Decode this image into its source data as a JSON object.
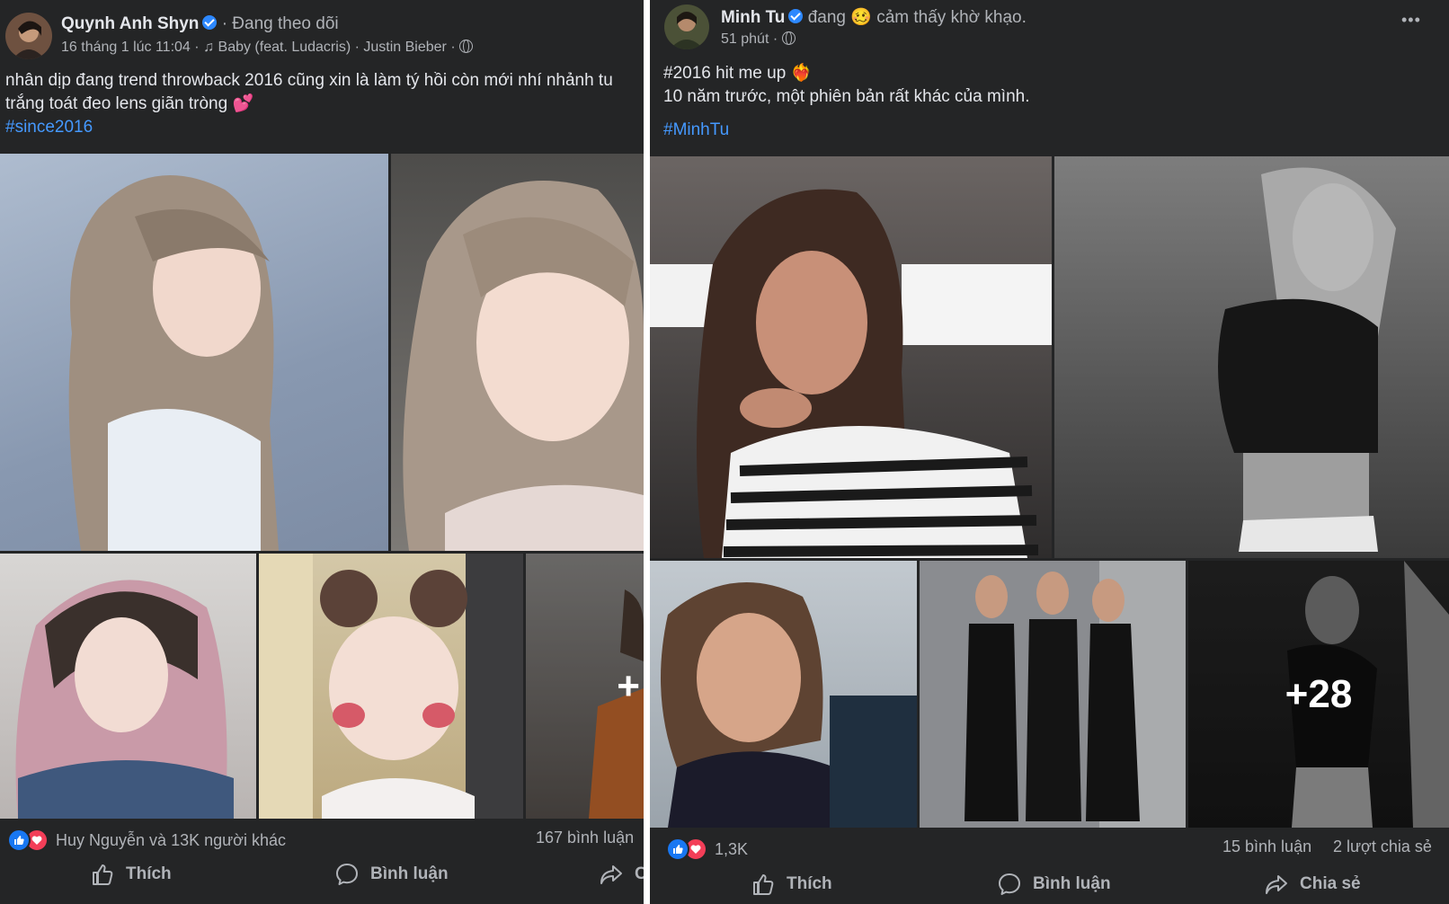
{
  "post1": {
    "author": "Quynh Anh Shyn",
    "follow_status": "· Đang theo dõi",
    "timestamp": "16 tháng 1 lúc 11:04",
    "song": "Baby (feat. Ludacris)",
    "artist": "Justin Bieber",
    "text_line1": "nhân dịp đang trend throwback 2016 cũng xin là làm tý hồi còn mới nhí nhảnh tu",
    "text_line2": "trắng toát đeo lens giãn tròng 💕",
    "hashtag": "#since2016",
    "overlay_partial": "+",
    "reactions_text": "Huy Nguyễn và 13K người khác",
    "comments": "167 bình luận",
    "actions": {
      "like": "Thích",
      "comment": "Bình luận",
      "share": "C"
    }
  },
  "post2": {
    "author": "Minh Tu",
    "feeling_prefix": "đang",
    "feeling_emoji": "🥴",
    "feeling": "cảm thấy khờ khạo.",
    "timestamp": "51 phút",
    "text_line1": "#2016 hit me up ❤️‍🔥",
    "text_line2": " 10 năm trước, một phiên bản rất khác của mình.",
    "hashtag": "#MinhTu",
    "more_label": "•••",
    "overlay_count": "+28",
    "reactions_count": "1,3K",
    "comments": "15 bình luận",
    "shares": "2 lượt chia sẻ",
    "actions": {
      "like": "Thích",
      "comment": "Bình luận",
      "share": "Chia sẻ"
    }
  },
  "colors": {
    "background": "#242526",
    "text": "#e4e6eb",
    "secondary": "#b0b3b8",
    "link": "#4599ff",
    "like": "#1877f2",
    "love": "#f33e58"
  }
}
